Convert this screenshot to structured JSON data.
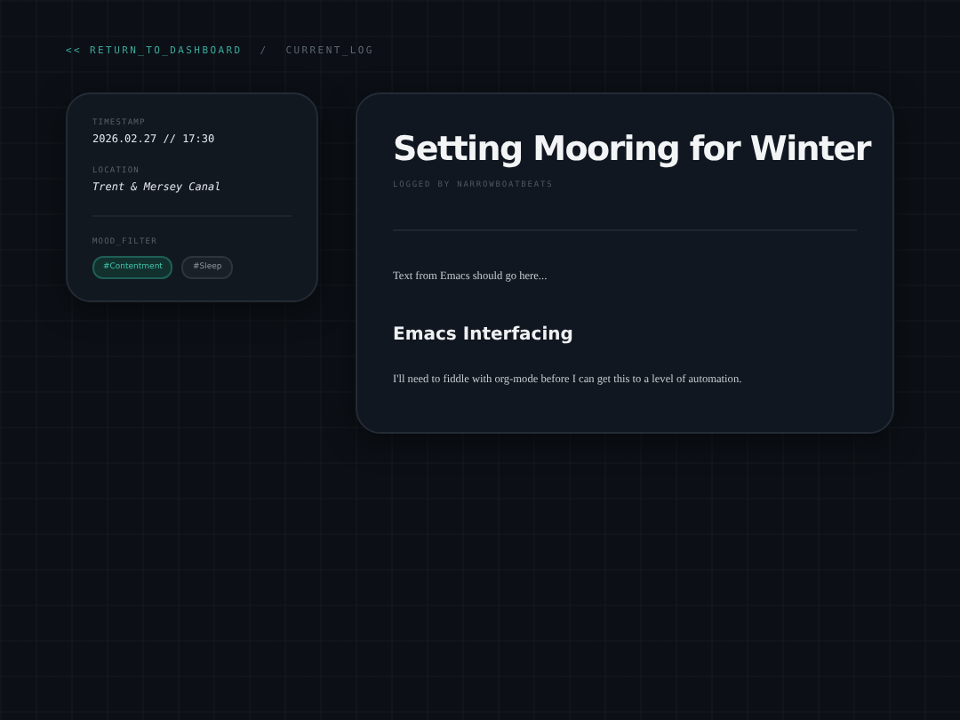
{
  "breadcrumb": {
    "back": "<< RETURN_TO_DASHBOARD",
    "separator": "/",
    "current": "CURRENT_LOG"
  },
  "meta": [
    {
      "label": "TIMESTAMP",
      "value": "2026.02.27 // 17:30",
      "kind": "plain"
    },
    {
      "label": "LOCATION",
      "value": "Trent & Mersey Canal",
      "kind": "italic"
    }
  ],
  "mood_filter": {
    "label": "MOOD_FILTER",
    "tags": [
      {
        "label": "#Contentment",
        "selected": true
      },
      {
        "label": "#Sleep",
        "selected": false
      }
    ]
  },
  "post": {
    "title": "Setting Mooring for Winter",
    "byline": "LOGGED BY NARROWBOATBEATS",
    "blocks": [
      {
        "kind": "paragraph",
        "text": "Text from Emacs should go here..."
      },
      {
        "kind": "heading",
        "text": "Emacs Interfacing"
      },
      {
        "kind": "paragraph",
        "text": "I'll need to fiddle with org-mode before I can get this to a level of automation."
      }
    ]
  }
}
